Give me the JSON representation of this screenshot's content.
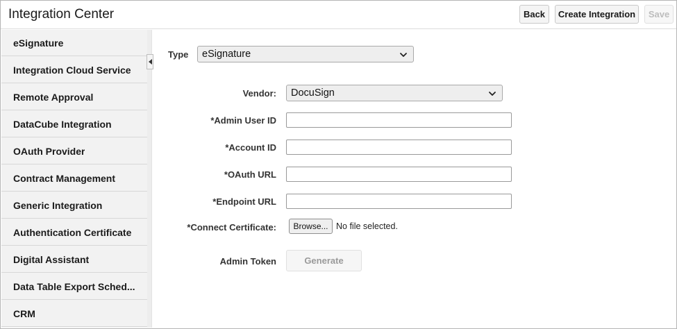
{
  "header": {
    "title": "Integration Center",
    "back_label": "Back",
    "create_label": "Create Integration",
    "save_label": "Save"
  },
  "sidebar": {
    "items": [
      {
        "label": "eSignature"
      },
      {
        "label": "Integration Cloud Service"
      },
      {
        "label": "Remote Approval"
      },
      {
        "label": "DataCube Integration"
      },
      {
        "label": "OAuth Provider"
      },
      {
        "label": "Contract Management"
      },
      {
        "label": "Generic Integration"
      },
      {
        "label": "Authentication Certificate"
      },
      {
        "label": "Digital Assistant"
      },
      {
        "label": "Data Table Export Sched..."
      },
      {
        "label": "CRM"
      }
    ]
  },
  "form": {
    "type_label": "Type",
    "type_value": "eSignature",
    "vendor_label": "Vendor:",
    "vendor_value": "DocuSign",
    "admin_user_id_label": "*Admin User ID",
    "admin_user_id_value": "",
    "account_id_label": "*Account ID",
    "account_id_value": "",
    "oauth_url_label": "*OAuth URL",
    "oauth_url_value": "",
    "endpoint_url_label": "*Endpoint URL",
    "endpoint_url_value": "",
    "connect_cert_label": "*Connect Certificate:",
    "browse_label": "Browse...",
    "file_status": "No file selected.",
    "admin_token_label": "Admin Token",
    "generate_label": "Generate"
  },
  "icons": {
    "dropdown": "chevron-down-icon",
    "collapse": "collapse-left-icon"
  }
}
